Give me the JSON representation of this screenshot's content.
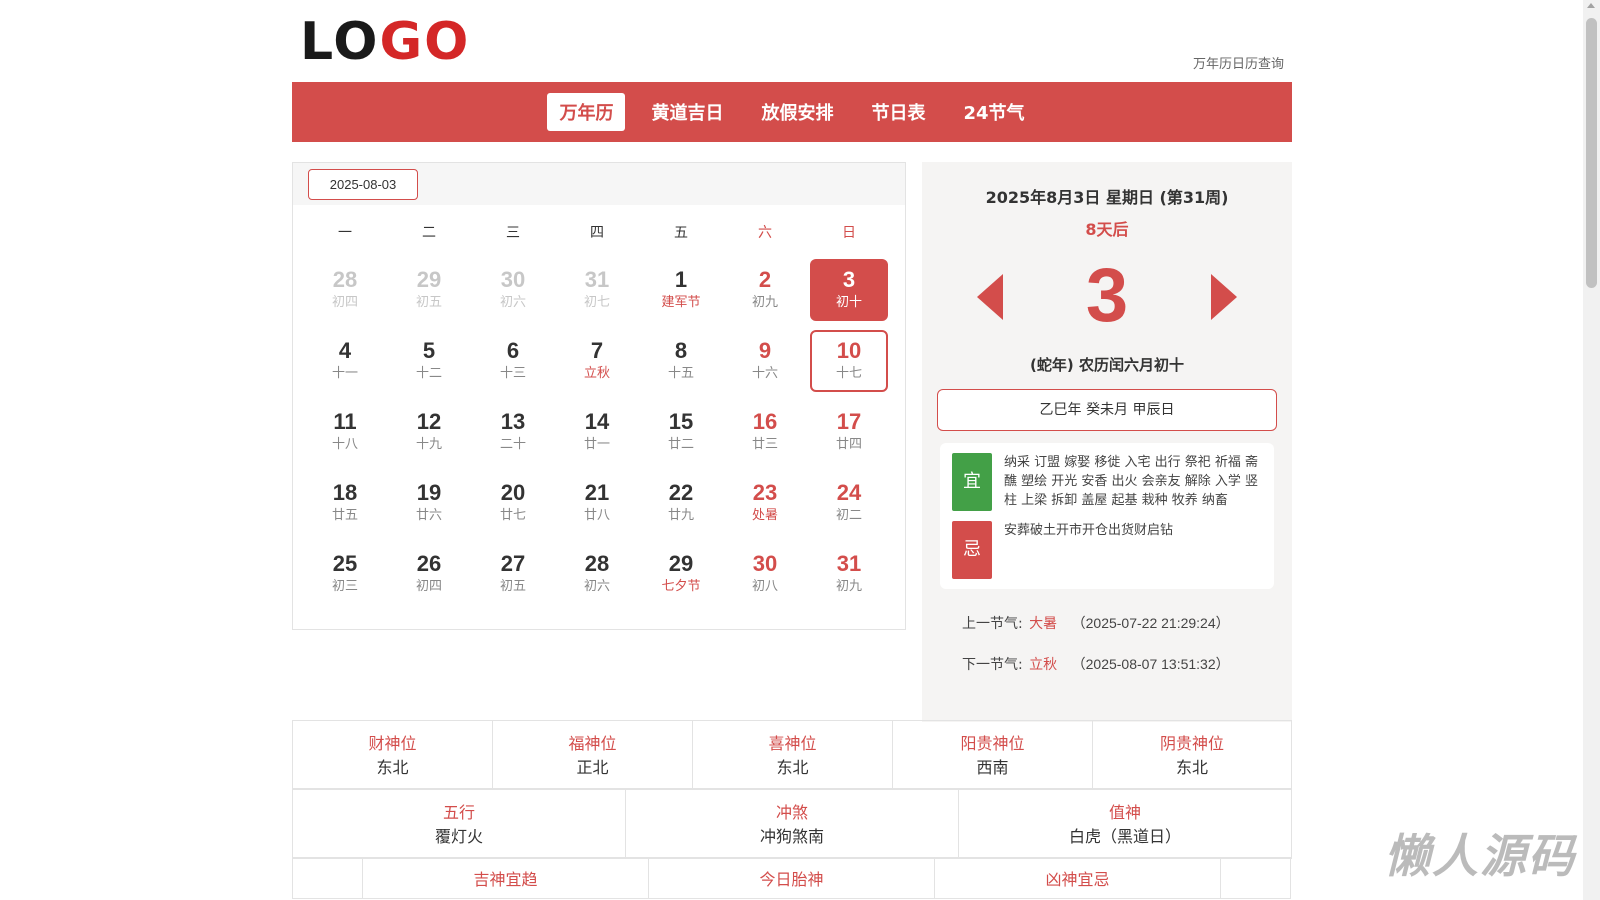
{
  "header": {
    "logo_dark": "LO",
    "logo_red": "GO",
    "link": "万年历日历查询"
  },
  "nav": {
    "items": [
      "万年历",
      "黄道吉日",
      "放假安排",
      "节日表",
      "24节气"
    ],
    "active": 0
  },
  "calendar": {
    "date_input": "2025-08-03",
    "weekdays": [
      "一",
      "二",
      "三",
      "四",
      "五",
      "六",
      "日"
    ],
    "days": [
      {
        "n": "28",
        "l": "初四",
        "other": true
      },
      {
        "n": "29",
        "l": "初五",
        "other": true
      },
      {
        "n": "30",
        "l": "初六",
        "other": true
      },
      {
        "n": "31",
        "l": "初七",
        "other": true
      },
      {
        "n": "1",
        "l": "建军节",
        "fest": true
      },
      {
        "n": "2",
        "l": "初九"
      },
      {
        "n": "3",
        "l": "初十",
        "selected": true
      },
      {
        "n": "4",
        "l": "十一"
      },
      {
        "n": "5",
        "l": "十二"
      },
      {
        "n": "6",
        "l": "十三"
      },
      {
        "n": "7",
        "l": "立秋",
        "fest": true
      },
      {
        "n": "8",
        "l": "十五"
      },
      {
        "n": "9",
        "l": "十六"
      },
      {
        "n": "10",
        "l": "十七",
        "outlined": true
      },
      {
        "n": "11",
        "l": "十八"
      },
      {
        "n": "12",
        "l": "十九"
      },
      {
        "n": "13",
        "l": "二十"
      },
      {
        "n": "14",
        "l": "廿一"
      },
      {
        "n": "15",
        "l": "廿二"
      },
      {
        "n": "16",
        "l": "廿三"
      },
      {
        "n": "17",
        "l": "廿四"
      },
      {
        "n": "18",
        "l": "廿五"
      },
      {
        "n": "19",
        "l": "廿六"
      },
      {
        "n": "20",
        "l": "廿七"
      },
      {
        "n": "21",
        "l": "廿八"
      },
      {
        "n": "22",
        "l": "廿九"
      },
      {
        "n": "23",
        "l": "处暑",
        "fest": true
      },
      {
        "n": "24",
        "l": "初二"
      },
      {
        "n": "25",
        "l": "初三"
      },
      {
        "n": "26",
        "l": "初四"
      },
      {
        "n": "27",
        "l": "初五"
      },
      {
        "n": "28",
        "l": "初六"
      },
      {
        "n": "29",
        "l": "七夕节",
        "fest": true
      },
      {
        "n": "30",
        "l": "初八"
      },
      {
        "n": "31",
        "l": "初九"
      }
    ]
  },
  "detail": {
    "date_line": "2025年8月3日 星期日 (第31周)",
    "after": "8天后",
    "big_day": "3",
    "lunar_line": "(蛇年) 农历闰六月初十",
    "ganzhi": "乙巳年 癸未月 甲辰日",
    "yi_label": "宜",
    "yi_text": "纳采 订盟 嫁娶 移徙 入宅 出行 祭祀 祈福 斋醮 塑绘 开光 安香 出火 会亲友 解除 入学 竖柱 上梁 拆卸 盖屋 起基 栽种 牧养 纳畜",
    "ji_label": "忌",
    "ji_text": "安葬破土开市开仓出货财启钻",
    "prev_label": "上一节气:",
    "prev_term": "大暑",
    "prev_time": "（2025-07-22 21:29:24）",
    "next_label": "下一节气:",
    "next_term": "立秋",
    "next_time": "（2025-08-07 13:51:32）"
  },
  "info": {
    "row1": [
      {
        "label": "财神位",
        "value": "东北"
      },
      {
        "label": "福神位",
        "value": "正北"
      },
      {
        "label": "喜神位",
        "value": "东北"
      },
      {
        "label": "阳贵神位",
        "value": "西南"
      },
      {
        "label": "阴贵神位",
        "value": "东北"
      }
    ],
    "row2": [
      {
        "label": "五行",
        "value": "覆灯火"
      },
      {
        "label": "冲煞",
        "value": "冲狗煞南"
      },
      {
        "label": "值神",
        "value": "白虎（黑道日）"
      }
    ],
    "row3": [
      "吉神宜趋",
      "今日胎神",
      "凶神宜忌"
    ]
  },
  "watermark": "懒人源码"
}
